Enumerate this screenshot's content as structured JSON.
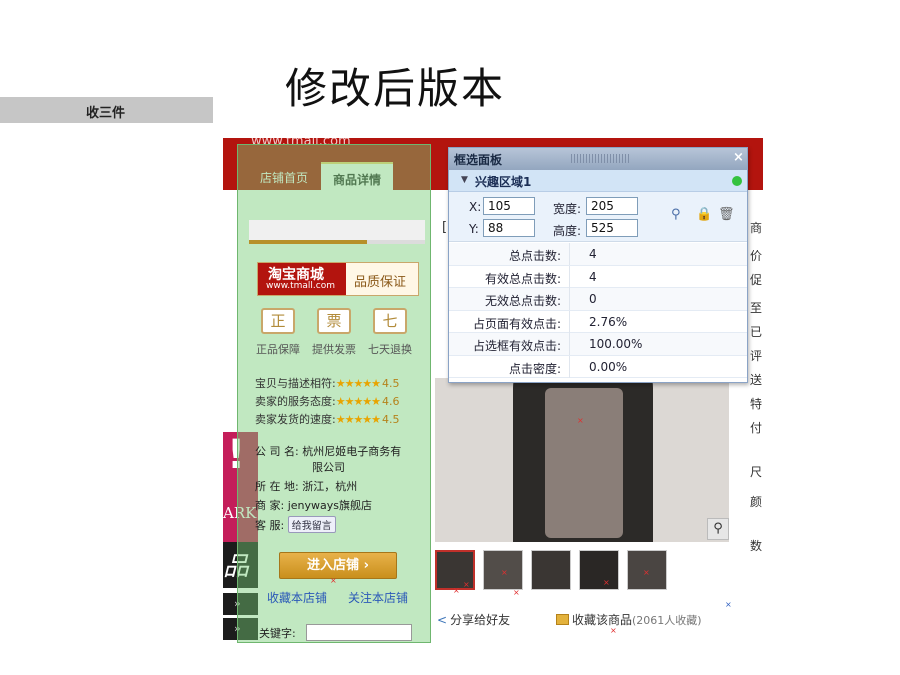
{
  "slide": {
    "title": "修改后版本",
    "left_bar_label": "收三件"
  },
  "page": {
    "url": "www.tmall.com",
    "tabs": [
      {
        "label": "店铺首页"
      },
      {
        "label": "商品详情"
      }
    ],
    "bracket_char": "[",
    "side_chars": [
      "商",
      "价",
      "促",
      "至",
      "已",
      "评",
      "送",
      "特",
      "付",
      "尺",
      "颜",
      "数"
    ],
    "share_label": "分享给好友",
    "fav_label": "收藏该商品",
    "fav_count": "(2061人收藏)",
    "zoom_icon": "magnifier-icon"
  },
  "sidebar": {
    "tmall_logo_main": "淘宝商城",
    "tmall_logo_sub": "www.tmall.com",
    "tmall_quality": "品质保证",
    "guarantees": [
      {
        "icon": "正",
        "label": "正品保障"
      },
      {
        "icon": "票",
        "label": "提供发票"
      },
      {
        "icon": "七",
        "label": "七天退换"
      }
    ],
    "ratings": [
      {
        "label": "宝贝与描述相符:",
        "stars": "★★★★★",
        "score": "4.5"
      },
      {
        "label": "卖家的服务态度:",
        "stars": "★★★★★",
        "score": "4.6"
      },
      {
        "label": "卖家发货的速度:",
        "stars": "★★★★★",
        "score": "4.5"
      }
    ],
    "company_label": "公 司 名:",
    "company_value": "杭州尼姬电子商务有",
    "company_value2": "限公司",
    "location_label": "所 在 地:",
    "location_value": "浙江，杭州",
    "seller_label": "商    家:",
    "seller_value": "jenyways旗舰店",
    "service_label": "客    服:",
    "service_value": "给我留言",
    "enter_button": "进入店铺 ›",
    "fav_shop": "收藏本店铺",
    "follow_shop": "关注本店铺",
    "keyword_label": "关键字:"
  },
  "banners": {
    "mark": "!",
    "ark": "ARK",
    "pin": "品",
    "arrows": [
      "»",
      "»"
    ]
  },
  "panel": {
    "title": "框选面板",
    "close": "×",
    "region_name": "兴趣区域1",
    "x_label": "X:",
    "x_value": "105",
    "y_label": "Y:",
    "y_value": "88",
    "w_label": "宽度:",
    "w_value": "205",
    "h_label": "高度:",
    "h_value": "525",
    "stats": [
      {
        "label": "总点击数:",
        "value": "4"
      },
      {
        "label": "有效总点击数:",
        "value": "4"
      },
      {
        "label": "无效总点击数:",
        "value": "0"
      },
      {
        "label": "占页面有效点击:",
        "value": "2.76%"
      },
      {
        "label": "占选框有效点击:",
        "value": "100.00%"
      },
      {
        "label": "点击密度:",
        "value": "0.00%"
      }
    ]
  }
}
